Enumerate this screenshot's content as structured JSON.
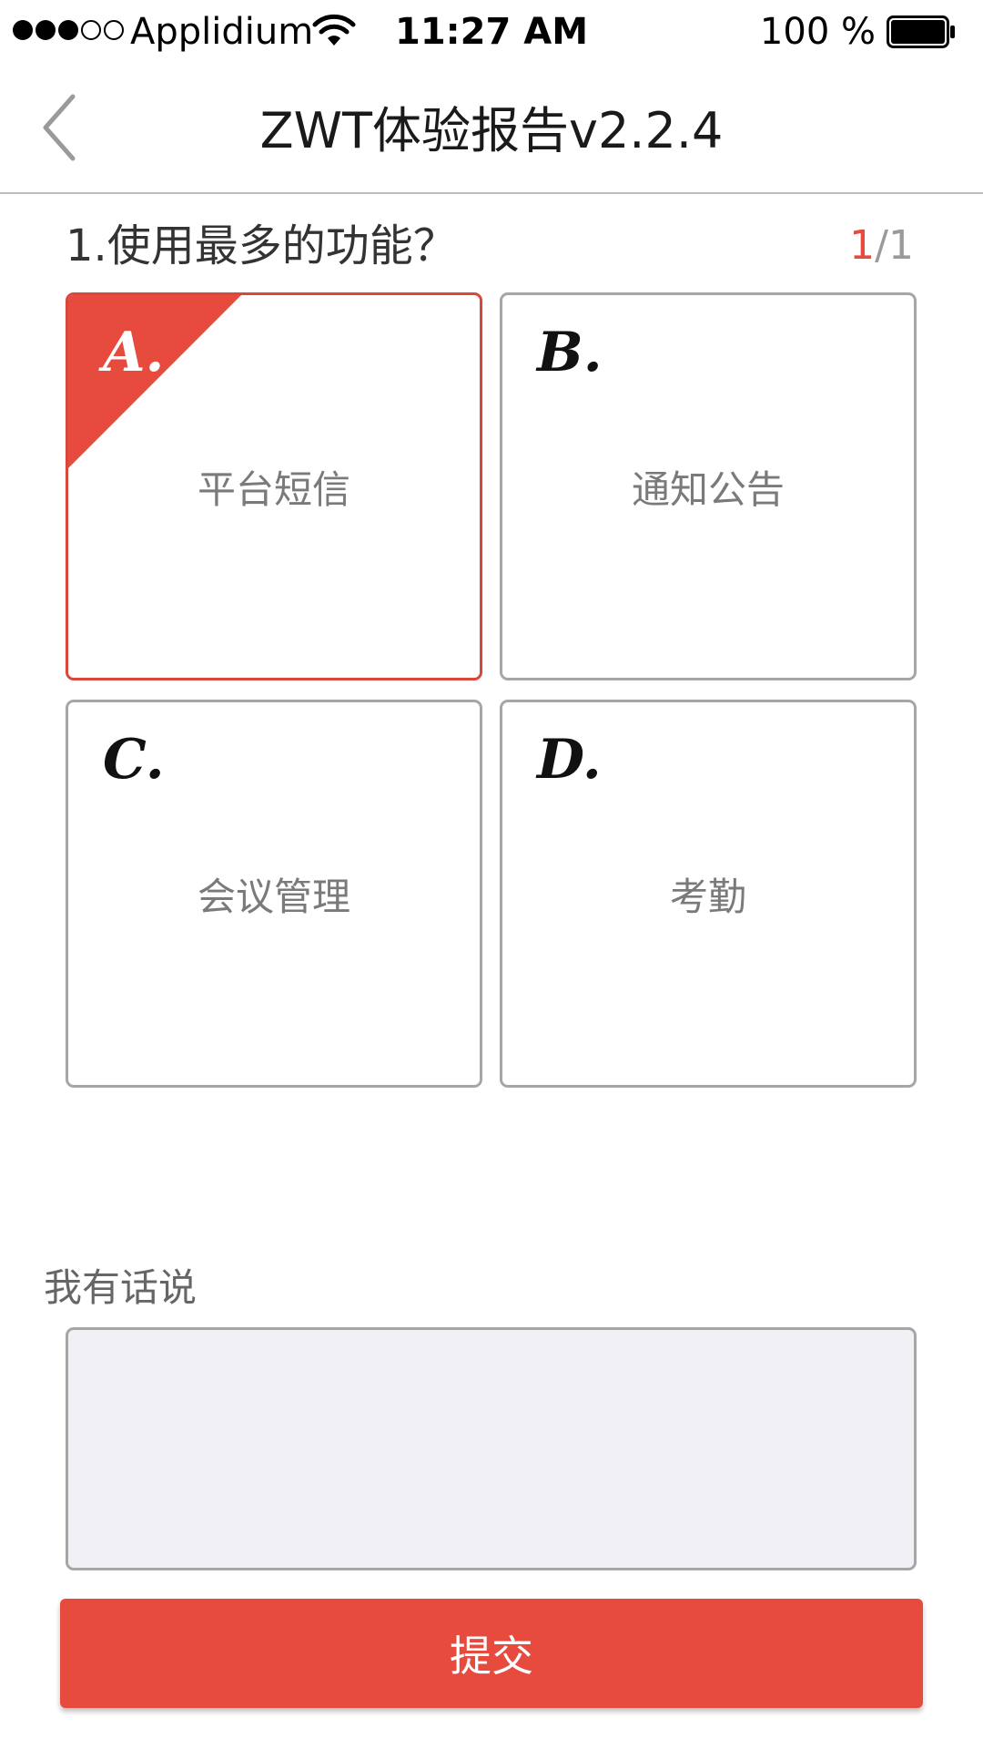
{
  "status_bar": {
    "carrier": "Applidium",
    "time": "11:27 AM",
    "battery_percent": "100 %",
    "signal_bars_filled": 3,
    "signal_bars_total": 5
  },
  "nav": {
    "back_icon": "chevron-left-icon",
    "title": "ZWT体验报告v2.2.4"
  },
  "question": {
    "text": "1.使用最多的功能？",
    "progress_current": "1",
    "progress_total": "/1"
  },
  "options": [
    {
      "letter": "A.",
      "label": "平台短信",
      "selected": true
    },
    {
      "letter": "B.",
      "label": "通知公告",
      "selected": false
    },
    {
      "letter": "C.",
      "label": "会议管理",
      "selected": false
    },
    {
      "letter": "D.",
      "label": "考勤",
      "selected": false
    }
  ],
  "comment": {
    "label": "我有话说",
    "value": "",
    "placeholder": ""
  },
  "submit": {
    "label": "提交"
  },
  "colors": {
    "accent": "#e64b3e",
    "border": "#a6a6a6",
    "comment_bg": "#f0f0f5",
    "text_muted": "#7a7a7a"
  }
}
